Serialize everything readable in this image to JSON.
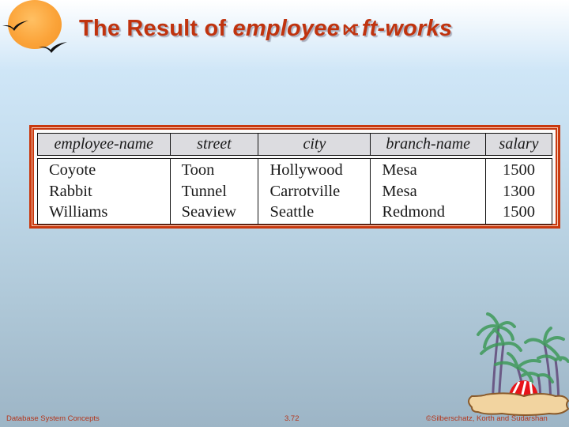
{
  "slide": {
    "title_prefix": "The Result of ",
    "title_left_operand": "employee",
    "title_operator": "⟖",
    "title_right_operand": "ft-works"
  },
  "table": {
    "columns": [
      "employee-name",
      "street",
      "city",
      "branch-name",
      "salary"
    ],
    "rows": [
      [
        "Coyote",
        "Toon",
        "Hollywood",
        "Mesa",
        "1500"
      ],
      [
        "Rabbit",
        "Tunnel",
        "Carrotville",
        "Mesa",
        "1300"
      ],
      [
        "Williams",
        "Seaview",
        "Seattle",
        "Redmond",
        "1500"
      ]
    ]
  },
  "footer": {
    "left": "Database System Concepts",
    "center": "3.72",
    "right": "©Silberschatz, Korth and Sudarshan"
  },
  "decor": {
    "top_left_icon": "sun-with-birds-icon",
    "bottom_right_icon": "palm-island-icon"
  },
  "colors": {
    "title": "#c0330e",
    "frame": "#c8390f",
    "header_bg": "#dcdce0",
    "footer_text": "#b3361c"
  }
}
